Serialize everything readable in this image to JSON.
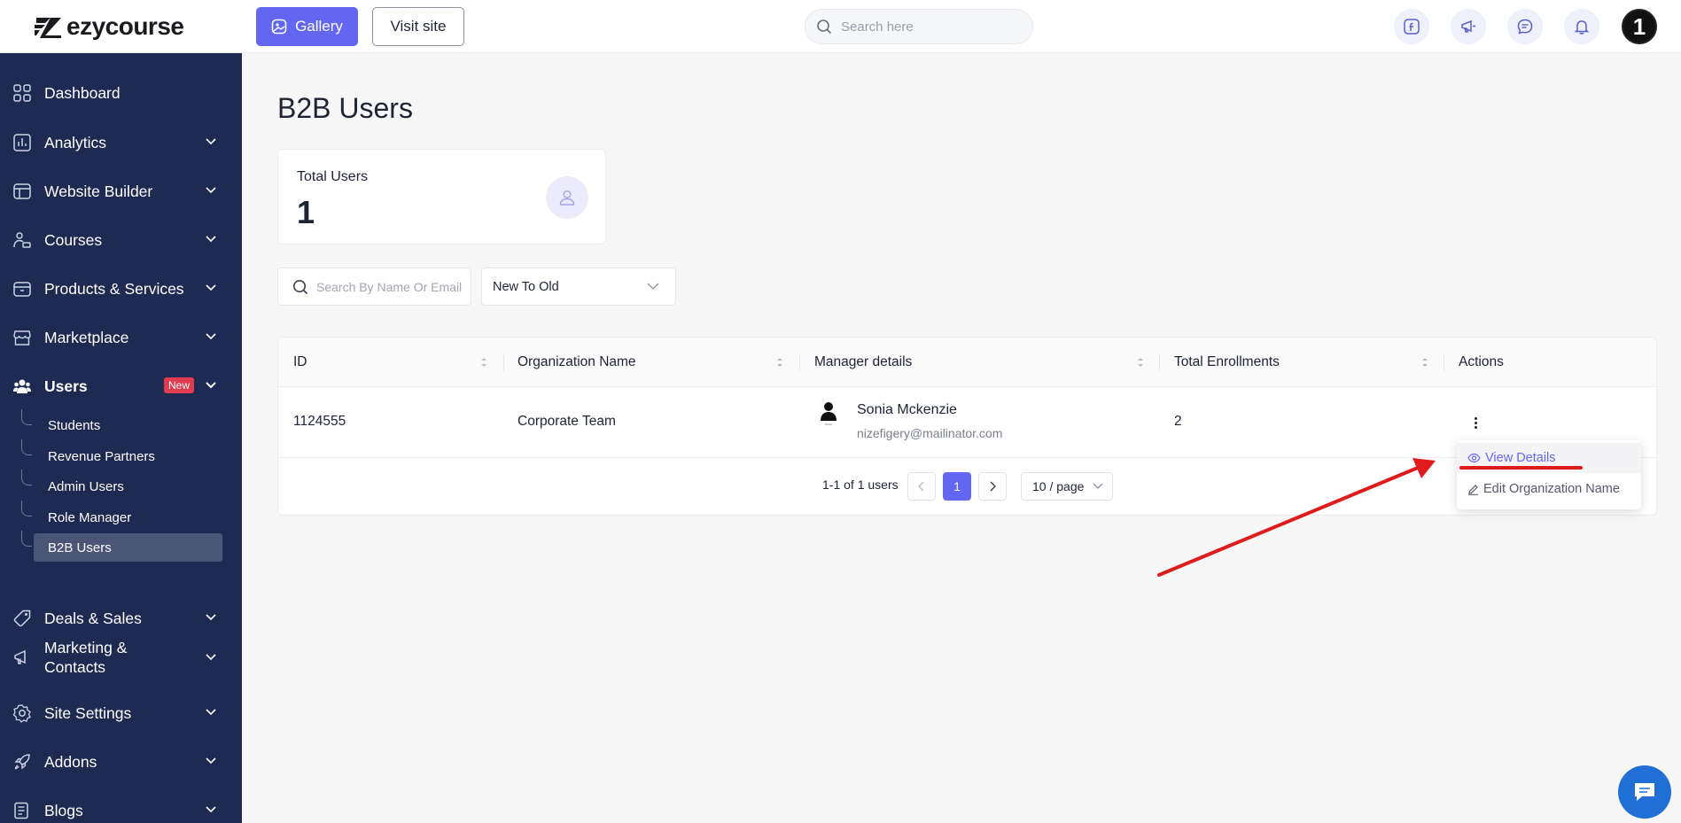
{
  "brand": {
    "name": "ezycourse"
  },
  "topbar": {
    "gallery_label": "Gallery",
    "visit_label": "Visit site",
    "search_placeholder": "Search here",
    "avatar_text": "1"
  },
  "sidebar": {
    "items": [
      {
        "label": "Dashboard"
      },
      {
        "label": "Analytics"
      },
      {
        "label": "Website Builder"
      },
      {
        "label": "Courses"
      },
      {
        "label": "Products & Services"
      },
      {
        "label": "Marketplace"
      },
      {
        "label": "Users",
        "badge": "New"
      },
      {
        "label": "Deals & Sales"
      },
      {
        "label": "Marketing &\nContacts"
      },
      {
        "label": "Site Settings"
      },
      {
        "label": "Addons"
      },
      {
        "label": "Blogs"
      }
    ],
    "users_sub": [
      {
        "label": "Students"
      },
      {
        "label": "Revenue Partners"
      },
      {
        "label": "Admin Users"
      },
      {
        "label": "Role Manager"
      },
      {
        "label": "B2B Users",
        "active": true
      }
    ]
  },
  "main": {
    "title": "B2B Users",
    "stat": {
      "label": "Total Users",
      "value": "1"
    },
    "filter": {
      "search_placeholder": "Search By Name Or Email",
      "sort_value": "New To Old"
    },
    "table": {
      "columns": [
        "ID",
        "Organization Name",
        "Manager details",
        "Total Enrollments",
        "Actions"
      ],
      "rows": [
        {
          "id": "1124555",
          "org": "Corporate Team",
          "manager_name": "Sonia Mckenzie",
          "manager_email": "nizefigery@mailinator.com",
          "enrollments": "2"
        }
      ]
    },
    "pagination": {
      "summary": "1-1 of 1 users",
      "current": "1",
      "page_size": "10 / page"
    },
    "actions_menu": {
      "view": "View Details",
      "edit": "Edit Organization Name"
    }
  },
  "colors": {
    "accent": "#6366f1",
    "sidebar_bg": "#1d2a52",
    "badge": "#e23a4f",
    "annotation": "#e01b1b",
    "chat_fab": "#1f6fd6"
  }
}
